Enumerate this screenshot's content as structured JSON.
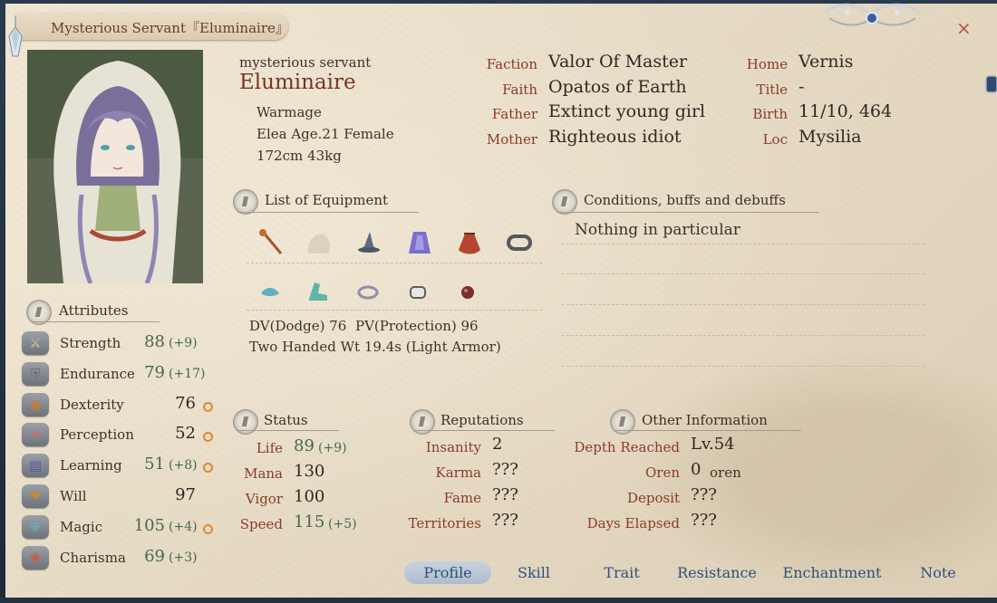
{
  "window": {
    "title": "Mysterious Servant『Eluminaire』",
    "close_glyph": "×"
  },
  "identity": {
    "subtitle": "mysterious servant",
    "name": "Eluminaire",
    "class": "Warmage",
    "race_age_sex": "Elea Age.21 Female",
    "height_weight": "172cm 43kg"
  },
  "profile_left": [
    {
      "label": "Faction",
      "value": "Valor Of Master"
    },
    {
      "label": "Faith",
      "value": "Opatos of Earth"
    },
    {
      "label": "Father",
      "value": "Extinct young girl"
    },
    {
      "label": "Mother",
      "value": "Righteous idiot"
    }
  ],
  "profile_right": [
    {
      "label": "Home",
      "value": "Vernis"
    },
    {
      "label": "Title",
      "value": "-"
    },
    {
      "label": "Birth",
      "value": "11/10, 464"
    },
    {
      "label": "Loc",
      "value": "Mysilia"
    }
  ],
  "equipment": {
    "heading": "List of Equipment",
    "row1_icons": [
      "staff-icon",
      "empty-slot-icon",
      "witch-hat-icon",
      "cloak-icon",
      "pouch-icon",
      "ring-icon"
    ],
    "row2_icons": [
      "gloves-icon",
      "boots-icon",
      "amulet-icon",
      "bracer-icon",
      "gem-icon"
    ],
    "dv": "DV(Dodge) 76",
    "pv": "PV(Protection) 96",
    "weight": "Two Handed Wt 19.4s (Light Armor)"
  },
  "conditions": {
    "heading": "Conditions, buffs and debuffs",
    "text": "Nothing in particular"
  },
  "attributes": {
    "heading": "Attributes",
    "items": [
      {
        "name": "Strength",
        "value": "88",
        "bonus": "(+9)",
        "potential": false,
        "icon": "sword-icon"
      },
      {
        "name": "Endurance",
        "value": "79",
        "bonus": "(+17)",
        "potential": false,
        "icon": "armor-icon"
      },
      {
        "name": "Dexterity",
        "value": "76",
        "bonus": "",
        "potential": true,
        "icon": "dexterity-icon"
      },
      {
        "name": "Perception",
        "value": "52",
        "bonus": "",
        "potential": true,
        "icon": "perception-icon"
      },
      {
        "name": "Learning",
        "value": "51",
        "bonus": "(+8)",
        "potential": true,
        "icon": "book-icon"
      },
      {
        "name": "Will",
        "value": "97",
        "bonus": "",
        "potential": false,
        "icon": "will-icon"
      },
      {
        "name": "Magic",
        "value": "105",
        "bonus": "(+4)",
        "potential": true,
        "icon": "magic-icon"
      },
      {
        "name": "Charisma",
        "value": "69",
        "bonus": "(+3)",
        "potential": false,
        "icon": "charisma-icon"
      }
    ]
  },
  "status": {
    "heading": "Status",
    "items": [
      {
        "label": "Life",
        "value": "89",
        "bonus": "(+9)"
      },
      {
        "label": "Mana",
        "value": "130",
        "bonus": ""
      },
      {
        "label": "Vigor",
        "value": "100",
        "bonus": ""
      },
      {
        "label": "Speed",
        "value": "115",
        "bonus": "(+5)"
      }
    ]
  },
  "reputations": {
    "heading": "Reputations",
    "items": [
      {
        "label": "Insanity",
        "value": "2"
      },
      {
        "label": "Karma",
        "value": "???"
      },
      {
        "label": "Fame",
        "value": "???"
      },
      {
        "label": "Territories",
        "value": "???"
      }
    ]
  },
  "other": {
    "heading": "Other Information",
    "items": [
      {
        "label": "Depth Reached",
        "value": "Lv.54",
        "unit": ""
      },
      {
        "label": "Oren",
        "value": "0",
        "unit": "oren"
      },
      {
        "label": "Deposit",
        "value": "???",
        "unit": ""
      },
      {
        "label": "Days Elapsed",
        "value": "???",
        "unit": ""
      }
    ]
  },
  "tabs": [
    "Profile",
    "Skill",
    "Trait",
    "Resistance",
    "Enchantment",
    "Note"
  ],
  "active_tab": "Profile"
}
